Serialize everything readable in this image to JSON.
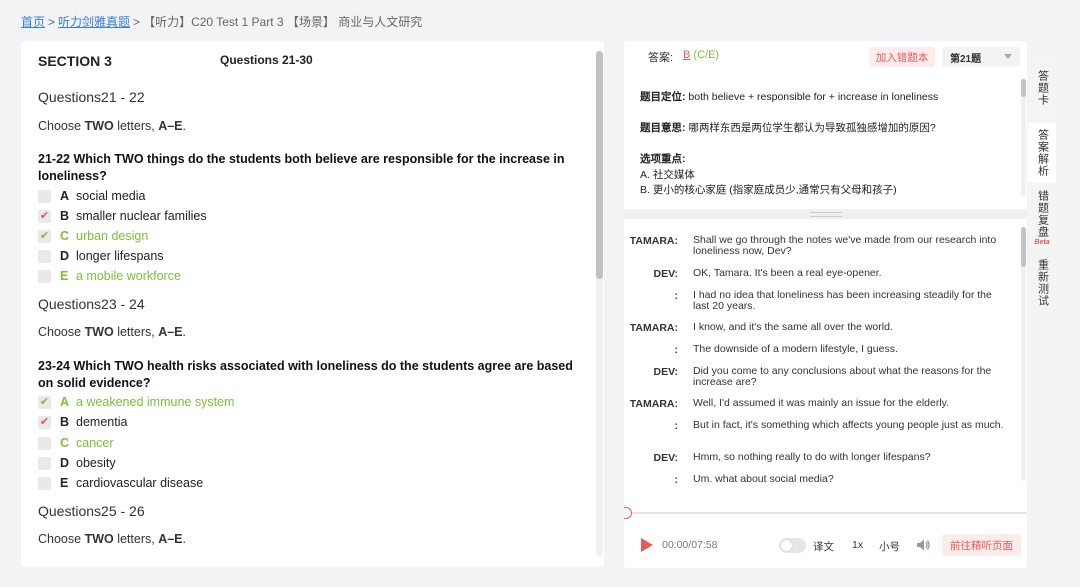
{
  "breadcrumb": {
    "home": "首页",
    "section": "听力剑雅真题",
    "current": "【听力】C20 Test 1 Part 3 【场景】 商业与人文研究"
  },
  "section": {
    "title": "SECTION 3",
    "questions": "Questions 21-30"
  },
  "groups": [
    {
      "title": "Questions21 - 22",
      "choose_prefix": "Choose ",
      "choose_bold": "TWO",
      "choose_mid": " letters, ",
      "choose_range": "A–E",
      "choose_end": "."
    },
    {
      "title": "Questions23 - 24",
      "choose_prefix": "Choose ",
      "choose_bold": "TWO",
      "choose_mid": " letters, ",
      "choose_range": "A–E",
      "choose_end": "."
    },
    {
      "title": "Questions25 - 26",
      "choose_prefix": "Choose ",
      "choose_bold": "TWO",
      "choose_mid": " letters, ",
      "choose_range": "A–E",
      "choose_end": "."
    }
  ],
  "q1": {
    "text": "21-22  Which TWO things do the students both believe are responsible for the increase in loneliness?",
    "options": [
      {
        "letter": "A",
        "text": "social media",
        "mark": ""
      },
      {
        "letter": "B",
        "text": "smaller nuclear families",
        "mark": "✔"
      },
      {
        "letter": "C",
        "text": "urban design",
        "mark": "✔"
      },
      {
        "letter": "D",
        "text": "longer lifespans",
        "mark": ""
      },
      {
        "letter": "E",
        "text": "a mobile workforce",
        "mark": ""
      }
    ]
  },
  "q2": {
    "text": "23-24  Which TWO health risks associated with loneliness do the students agree are based on solid evidence?",
    "options": [
      {
        "letter": "A",
        "text": "a weakened immune system",
        "mark": "✔"
      },
      {
        "letter": "B",
        "text": "dementia",
        "mark": "✔"
      },
      {
        "letter": "C",
        "text": "cancer",
        "mark": ""
      },
      {
        "letter": "D",
        "text": "obesity",
        "mark": ""
      },
      {
        "letter": "E",
        "text": "cardiovascular disease",
        "mark": ""
      }
    ]
  },
  "answer": {
    "label": "答案:",
    "value": "B",
    "alt": "(C/E)",
    "add_wrong": "加入错题本",
    "question_select": "第21题"
  },
  "analysis": {
    "locate_key": "题目定位:",
    "locate_val": "both believe + responsible for + increase in loneliness",
    "meaning_key": "题目意思:",
    "meaning_val": "哪两样东西是两位学生都认为导致孤独感增加的原因?",
    "points_key": "选项重点:",
    "point_a": "A. 社交媒体",
    "point_b": "B. 更小的核心家庭 (指家庭成员少,通常只有父母和孩子)"
  },
  "transcript": [
    {
      "speaker": "TAMARA:",
      "text": "Shall we go through the notes we've made from our research into loneliness now, Dev?"
    },
    {
      "speaker": "DEV:",
      "text": "OK, Tamara. It's been a real eye-opener."
    },
    {
      "speaker": ":",
      "text": "I had no idea that loneliness has been increasing steadily for the last 20 years."
    },
    {
      "speaker": "TAMARA:",
      "text": "I know, and it's the same all over the world."
    },
    {
      "speaker": ":",
      "text": "The downside of a modern lifestyle, I guess."
    },
    {
      "speaker": "DEV:",
      "text": "Did you come to any conclusions about what the reasons for the increase are?"
    },
    {
      "speaker": "TAMARA:",
      "text": "Well, I'd assumed it was mainly an issue for the elderly."
    },
    {
      "speaker": ":",
      "text": "But in fact, it's something which affects young people just as much."
    },
    {
      "speaker": "DEV:",
      "text": "Hmm, so nothing really to do with longer lifespans?"
    },
    {
      "speaker": ":",
      "text": "Um. what about social media?"
    }
  ],
  "player": {
    "time": "00:00/07:58",
    "translate": "译文",
    "speed": "1x",
    "font_size": "小号",
    "go_button": "前往精听页面"
  },
  "side_tabs": [
    {
      "label": "答题卡"
    },
    {
      "label": "答案解析"
    },
    {
      "label": "错题复盘",
      "badge": "Beta"
    },
    {
      "label": "重新测试"
    }
  ],
  "colors": {
    "accent": "#e55a5a",
    "correct": "#7bbf3a",
    "link": "#3b7ddd"
  }
}
